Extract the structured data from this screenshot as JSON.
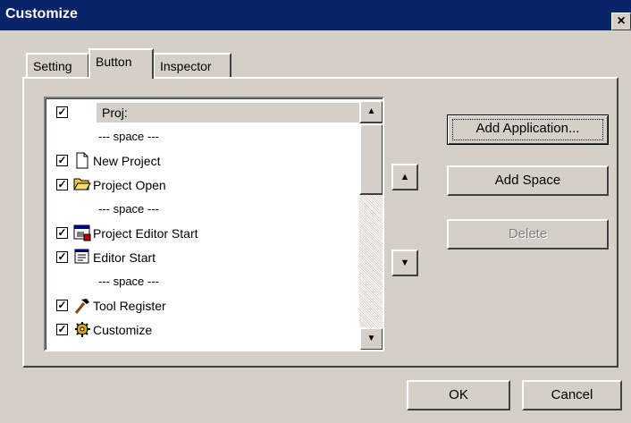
{
  "window": {
    "title": "Customize",
    "close_icon": "×"
  },
  "tabs": [
    {
      "label": "Setting",
      "active": false
    },
    {
      "label": "Button",
      "active": true
    },
    {
      "label": "Inspector",
      "active": false
    }
  ],
  "list": {
    "items": [
      {
        "label": "Proj:",
        "checked": true,
        "icon": "",
        "selected": true
      },
      {
        "label": "--- space ---",
        "checked": false,
        "icon": "",
        "spacer": true
      },
      {
        "label": "New Project",
        "checked": true,
        "icon": "document-icon"
      },
      {
        "label": "Project Open",
        "checked": true,
        "icon": "folder-open-icon"
      },
      {
        "label": "--- space ---",
        "checked": false,
        "icon": "",
        "spacer": true
      },
      {
        "label": "Project Editor Start",
        "checked": true,
        "icon": "window-app-icon"
      },
      {
        "label": "Editor Start",
        "checked": true,
        "icon": "editor-icon"
      },
      {
        "label": "--- space ---",
        "checked": false,
        "icon": "",
        "spacer": true
      },
      {
        "label": "Tool Register",
        "checked": true,
        "icon": "hammer-icon"
      },
      {
        "label": "Customize",
        "checked": true,
        "icon": "gear-icon"
      }
    ]
  },
  "buttons": {
    "add_application": "Add Application...",
    "add_space": "Add Space",
    "delete": "Delete",
    "ok": "OK",
    "cancel": "Cancel",
    "move_up": "▲",
    "move_down": "▼"
  },
  "colors": {
    "titlebar": "#0a246a",
    "face": "#d4d0c8"
  }
}
